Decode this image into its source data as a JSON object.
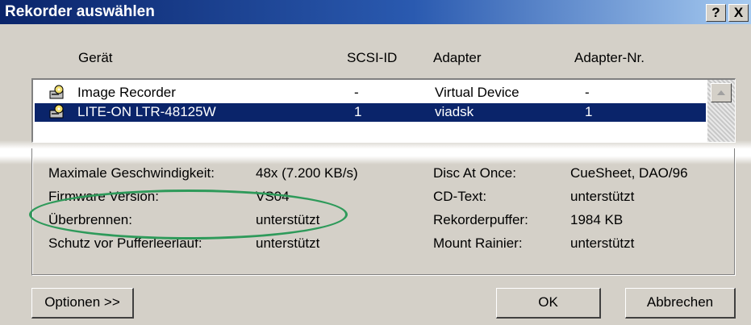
{
  "window": {
    "title": "Rekorder auswählen",
    "help_button": "?",
    "close_button": "X"
  },
  "columns": [
    "Gerät",
    "SCSI-ID",
    "Adapter",
    "Adapter-Nr."
  ],
  "devices": [
    {
      "name": "Image Recorder",
      "scsi_id": "-",
      "adapter": "Virtual Device",
      "adapter_nr": "-",
      "selected": false
    },
    {
      "name": "LITE-ON  LTR-48125W",
      "scsi_id": "1",
      "adapter": "viadsk",
      "adapter_nr": "1",
      "selected": true
    }
  ],
  "properties": {
    "left": [
      {
        "label": "Maximale Geschwindigkeit:",
        "value": "48x (7.200 KB/s)"
      },
      {
        "label": "Firmware Version:",
        "value": "VS04"
      },
      {
        "label": "Überbrennen:",
        "value": "unterstützt"
      },
      {
        "label": "Schutz vor Pufferleerlauf:",
        "value": "unterstützt"
      }
    ],
    "right": [
      {
        "label": "Disc At Once:",
        "value": "CueSheet, DAO/96"
      },
      {
        "label": "CD-Text:",
        "value": "unterstützt"
      },
      {
        "label": "Rekorderpuffer:",
        "value": "1984 KB"
      },
      {
        "label": "Mount Rainier:",
        "value": "unterstützt"
      }
    ]
  },
  "buttons": {
    "options": "Optionen >>",
    "ok": "OK",
    "cancel": "Abbrechen"
  },
  "colors": {
    "selection": "#0a246a",
    "annotation_ring": "#2e9a5a"
  }
}
